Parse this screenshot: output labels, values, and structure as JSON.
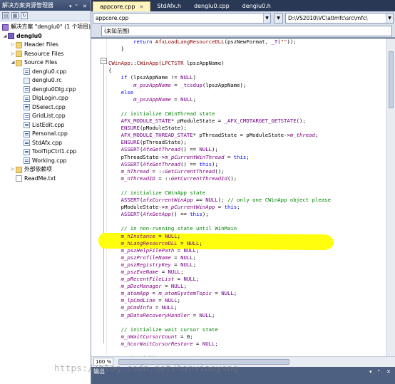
{
  "solution_explorer": {
    "title": "解决方案资源管理器",
    "toolbar_icons": [
      "properties-icon",
      "show-all-files-icon",
      "refresh-icon"
    ],
    "items": [
      {
        "label": "解决方案 \"denglu0\" (1 个项目)",
        "icon": "solution-icon",
        "level": 0,
        "expander": ""
      },
      {
        "label": "denglu0",
        "icon": "project-icon",
        "level": 0,
        "expander": "◢",
        "bold": true
      },
      {
        "label": "Header Files",
        "icon": "folder-icon",
        "level": 1,
        "expander": "▷"
      },
      {
        "label": "Resource Files",
        "icon": "folder-icon",
        "level": 1,
        "expander": "▷"
      },
      {
        "label": "Source Files",
        "icon": "folder-icon",
        "level": 1,
        "expander": "◢"
      },
      {
        "label": "denglu0.cpp",
        "icon": "cpp-file-icon",
        "level": 2,
        "expander": ""
      },
      {
        "label": "denglu0.rc",
        "icon": "rc-file-icon",
        "level": 2,
        "expander": ""
      },
      {
        "label": "denglu0Dlg.cpp",
        "icon": "cpp-file-icon",
        "level": 2,
        "expander": ""
      },
      {
        "label": "DlgLogin.cpp",
        "icon": "cpp-file-icon",
        "level": 2,
        "expander": ""
      },
      {
        "label": "DSelect.cpp",
        "icon": "cpp-file-icon",
        "level": 2,
        "expander": ""
      },
      {
        "label": "GridList.cpp",
        "icon": "cpp-file-icon",
        "level": 2,
        "expander": ""
      },
      {
        "label": "ListEdit.cpp",
        "icon": "cpp-file-icon",
        "level": 2,
        "expander": ""
      },
      {
        "label": "Personal.cpp",
        "icon": "cpp-file-icon",
        "level": 2,
        "expander": ""
      },
      {
        "label": "StdAfx.cpp",
        "icon": "cpp-file-icon",
        "level": 2,
        "expander": ""
      },
      {
        "label": "ToolTipCtrl1.cpp",
        "icon": "cpp-file-icon",
        "level": 2,
        "expander": ""
      },
      {
        "label": "Working.cpp",
        "icon": "cpp-file-icon",
        "level": 2,
        "expander": ""
      },
      {
        "label": "外部依赖项",
        "icon": "external-deps-icon",
        "level": 1,
        "expander": "▷"
      },
      {
        "label": "ReadMe.txt",
        "icon": "text-file-icon",
        "level": 1,
        "expander": ""
      }
    ]
  },
  "editor": {
    "tabs": [
      {
        "label": "appcore.cpp",
        "active": true
      },
      {
        "label": "StdAfx.h",
        "active": false
      },
      {
        "label": "denglu0.cpp",
        "active": false
      },
      {
        "label": "denglu0.h",
        "active": false
      }
    ],
    "file_combo": "appcore.cpp",
    "scope_combo": "(未知范围)",
    "path_combo": "D:\\VS2010\\VC\\atlmfc\\src\\mfc\\",
    "zoom": "100 %",
    "code_lines": [
      [
        {
          "t": "        "
        },
        {
          "t": "return",
          "c": "k"
        },
        {
          "t": " "
        },
        {
          "t": "AfxLoadLangResourceDLL",
          "c": "f"
        },
        {
          "t": "(pszNewFormat, "
        },
        {
          "t": "_T",
          "c": "m"
        },
        {
          "t": "("
        },
        {
          "t": "\"\"",
          "c": "s"
        },
        {
          "t": "));"
        }
      ],
      [
        {
          "t": "    }"
        }
      ],
      [
        {
          "t": ""
        }
      ],
      [
        {
          "t": "CWinApp",
          "c": "f"
        },
        {
          "t": "::"
        },
        {
          "t": "CWinApp",
          "c": "f"
        },
        {
          "t": "("
        },
        {
          "t": "LPCTSTR",
          "c": "f"
        },
        {
          "t": " lpszAppName)"
        }
      ],
      [
        {
          "t": "{"
        }
      ],
      [
        {
          "t": "    "
        },
        {
          "t": "if",
          "c": "k"
        },
        {
          "t": " (lpszAppName != "
        },
        {
          "t": "NULL",
          "c": "m"
        },
        {
          "t": ")"
        }
      ],
      [
        {
          "t": "        "
        },
        {
          "t": "m_pszAppName",
          "c": "i"
        },
        {
          "t": " = "
        },
        {
          "t": "_tcsdup",
          "c": "m"
        },
        {
          "t": "(lpszAppName);"
        }
      ],
      [
        {
          "t": "    "
        },
        {
          "t": "else",
          "c": "k"
        }
      ],
      [
        {
          "t": "        "
        },
        {
          "t": "m_pszAppName",
          "c": "i"
        },
        {
          "t": " = "
        },
        {
          "t": "NULL",
          "c": "m"
        },
        {
          "t": ";"
        }
      ],
      [
        {
          "t": ""
        }
      ],
      [
        {
          "t": "    "
        },
        {
          "t": "// initialize CWinThread state",
          "c": "c"
        }
      ],
      [
        {
          "t": "    "
        },
        {
          "t": "AFX_MODULE_STATE",
          "c": "m"
        },
        {
          "t": "* pModuleState = "
        },
        {
          "t": "_AFX_CMDTARGET_GETSTATE",
          "c": "m"
        },
        {
          "t": "();"
        }
      ],
      [
        {
          "t": "    "
        },
        {
          "t": "ENSURE",
          "c": "m"
        },
        {
          "t": "(pModuleState);"
        }
      ],
      [
        {
          "t": "    "
        },
        {
          "t": "AFX_MODULE_THREAD_STATE",
          "c": "m"
        },
        {
          "t": "* pThreadState = pModuleState->"
        },
        {
          "t": "m_thread",
          "c": "i"
        },
        {
          "t": ";"
        }
      ],
      [
        {
          "t": "    "
        },
        {
          "t": "ENSURE",
          "c": "m"
        },
        {
          "t": "(pThreadState);"
        }
      ],
      [
        {
          "t": "    "
        },
        {
          "t": "ASSERT",
          "c": "m"
        },
        {
          "t": "("
        },
        {
          "t": "AfxGetThread",
          "c": "i"
        },
        {
          "t": "() == "
        },
        {
          "t": "NULL",
          "c": "m"
        },
        {
          "t": ");"
        }
      ],
      [
        {
          "t": "    pThreadState->"
        },
        {
          "t": "m_pCurrentWinThread",
          "c": "i"
        },
        {
          "t": " = "
        },
        {
          "t": "this",
          "c": "k"
        },
        {
          "t": ";"
        }
      ],
      [
        {
          "t": "    "
        },
        {
          "t": "ASSERT",
          "c": "m"
        },
        {
          "t": "("
        },
        {
          "t": "AfxGetThread",
          "c": "i"
        },
        {
          "t": "() == "
        },
        {
          "t": "this",
          "c": "k"
        },
        {
          "t": ");"
        }
      ],
      [
        {
          "t": "    "
        },
        {
          "t": "m_hThread",
          "c": "i"
        },
        {
          "t": " = ::"
        },
        {
          "t": "GetCurrentThread",
          "c": "i"
        },
        {
          "t": "();"
        }
      ],
      [
        {
          "t": "    "
        },
        {
          "t": "m_nThreadID",
          "c": "i"
        },
        {
          "t": " = ::"
        },
        {
          "t": "GetCurrentThreadId",
          "c": "i"
        },
        {
          "t": "();"
        }
      ],
      [
        {
          "t": ""
        }
      ],
      [
        {
          "t": "    "
        },
        {
          "t": "// initialize CWinApp state",
          "c": "c"
        }
      ],
      [
        {
          "t": "    "
        },
        {
          "t": "ASSERT",
          "c": "m"
        },
        {
          "t": "("
        },
        {
          "t": "afxCurrentWinApp",
          "c": "i"
        },
        {
          "t": " == "
        },
        {
          "t": "NULL",
          "c": "m"
        },
        {
          "t": "); "
        },
        {
          "t": "// only one CWinApp object please",
          "c": "c"
        }
      ],
      [
        {
          "t": "    pModuleState->"
        },
        {
          "t": "m_pCurrentWinApp",
          "c": "i"
        },
        {
          "t": " = "
        },
        {
          "t": "this",
          "c": "k"
        },
        {
          "t": ";"
        }
      ],
      [
        {
          "t": "    "
        },
        {
          "t": "ASSERT",
          "c": "m"
        },
        {
          "t": "("
        },
        {
          "t": "AfxGetApp",
          "c": "i"
        },
        {
          "t": "() == "
        },
        {
          "t": "this",
          "c": "k"
        },
        {
          "t": ");"
        }
      ],
      [
        {
          "t": ""
        }
      ],
      [
        {
          "t": "    "
        },
        {
          "t": "// in non-running state until WinMain",
          "c": "c"
        }
      ],
      [
        {
          "t": "    "
        },
        {
          "t": "m_hInstance",
          "c": "i"
        },
        {
          "t": " = "
        },
        {
          "t": "NULL",
          "c": "m"
        },
        {
          "t": ";"
        }
      ],
      [
        {
          "t": "    "
        },
        {
          "t": "m_hLangResourceDLL",
          "c": "i"
        },
        {
          "t": " = "
        },
        {
          "t": "NULL",
          "c": "m"
        },
        {
          "t": ";"
        }
      ],
      [
        {
          "t": "    "
        },
        {
          "t": "m_pszHelpFilePath",
          "c": "i"
        },
        {
          "t": " = "
        },
        {
          "t": "NULL",
          "c": "m"
        },
        {
          "t": ";"
        }
      ],
      [
        {
          "t": "    "
        },
        {
          "t": "m_pszProfileName",
          "c": "i"
        },
        {
          "t": " = "
        },
        {
          "t": "NULL",
          "c": "m"
        },
        {
          "t": ";"
        }
      ],
      [
        {
          "t": "    "
        },
        {
          "t": "m_pszRegistryKey",
          "c": "i"
        },
        {
          "t": " = "
        },
        {
          "t": "NULL",
          "c": "m"
        },
        {
          "t": ";"
        }
      ],
      [
        {
          "t": "    "
        },
        {
          "t": "m_pszExeName",
          "c": "i"
        },
        {
          "t": " = "
        },
        {
          "t": "NULL",
          "c": "m"
        },
        {
          "t": ";"
        }
      ],
      [
        {
          "t": "    "
        },
        {
          "t": "m_pRecentFileList",
          "c": "i"
        },
        {
          "t": " = "
        },
        {
          "t": "NULL",
          "c": "m"
        },
        {
          "t": ";"
        }
      ],
      [
        {
          "t": "    "
        },
        {
          "t": "m_pDocManager",
          "c": "i"
        },
        {
          "t": " = "
        },
        {
          "t": "NULL",
          "c": "m"
        },
        {
          "t": ";"
        }
      ],
      [
        {
          "t": "    "
        },
        {
          "t": "m_atomApp",
          "c": "i"
        },
        {
          "t": " = "
        },
        {
          "t": "m_atomSystemTopic",
          "c": "i"
        },
        {
          "t": " = "
        },
        {
          "t": "NULL",
          "c": "m"
        },
        {
          "t": ";"
        }
      ],
      [
        {
          "t": "    "
        },
        {
          "t": "m_lpCmdLine",
          "c": "i"
        },
        {
          "t": " = "
        },
        {
          "t": "NULL",
          "c": "m"
        },
        {
          "t": ";"
        }
      ],
      [
        {
          "t": "    "
        },
        {
          "t": "m_pCmdInfo",
          "c": "i"
        },
        {
          "t": " = "
        },
        {
          "t": "NULL",
          "c": "m"
        },
        {
          "t": ";"
        }
      ],
      [
        {
          "t": "    "
        },
        {
          "t": "m_pDataRecoveryHandler",
          "c": "i"
        },
        {
          "t": " = "
        },
        {
          "t": "NULL",
          "c": "m"
        },
        {
          "t": ";"
        }
      ],
      [
        {
          "t": ""
        }
      ],
      [
        {
          "t": "    "
        },
        {
          "t": "// initialize wait cursor state",
          "c": "c"
        }
      ],
      [
        {
          "t": "    "
        },
        {
          "t": "m_nWaitCursorCount",
          "c": "i"
        },
        {
          "t": " = 0;"
        }
      ],
      [
        {
          "t": "    "
        },
        {
          "t": "m_hcurWaitCursorRestore",
          "c": "i"
        },
        {
          "t": " = "
        },
        {
          "t": "NULL",
          "c": "m"
        },
        {
          "t": ";"
        }
      ],
      [
        {
          "t": ""
        }
      ],
      [
        {
          "t": "    "
        },
        {
          "t": "// initialize current printer state",
          "c": "c"
        }
      ]
    ]
  },
  "output_panel": {
    "title": "输出"
  },
  "watermark": "https://blog.csdn.net/hanxiaoyong_"
}
